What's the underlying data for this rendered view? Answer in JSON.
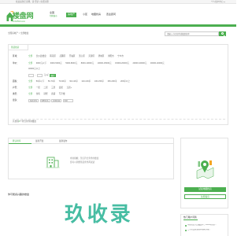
{
  "topbar": {
    "left": "欢迎来到亿房网，请 登录 | 免费注册",
    "right": "个人用户中心"
  },
  "brand": {
    "logo_cn": "楼盘网",
    "logo_en": "LOUPAN.com",
    "city": "全国",
    "city_switch": "切换城市"
  },
  "nav": {
    "items": [
      "房地产",
      "小区",
      "地图找房",
      "置业顾问"
    ],
    "active_index": 0
  },
  "breadcrumb": "全国房地产 > 全部楼盘",
  "search": {
    "placeholder": "请输入小区名称或楼盘名称",
    "button_icon": "search-icon"
  },
  "filters": {
    "tab_label": "筛选找房",
    "region": {
      "label": "区域：",
      "options": [
        "全部",
        "长沙县楼盘",
        "雨花区",
        "岳麓区",
        "开福区",
        "天心区",
        "芙蓉区",
        "望城区",
        "浏阳市",
        "宁乡市"
      ]
    },
    "price": {
      "label": "单价：",
      "options": [
        "全部",
        "3000元以下",
        "3000-5000元",
        "5000-8000元",
        "8000-10000元",
        "10000-15000元",
        "15000-20000元",
        "20000-30000元",
        "30000-40000元",
        "40000元以上"
      ],
      "range_sep": "-",
      "unit": "元/㎡",
      "confirm": "确定"
    },
    "area": {
      "label": "面积：",
      "options": [
        "全部",
        "50平以下",
        "50-70平",
        "70-90平",
        "90-110平",
        "110-130平",
        "130-150平",
        "150-200平",
        "200平以上"
      ]
    },
    "layout": {
      "label": "户型：",
      "options": [
        "全部",
        "一居",
        "二居",
        "三居",
        "四居",
        "五居+"
      ]
    },
    "type": {
      "label": "类型：",
      "options": [
        "全部",
        "住宅",
        "别墅",
        "商铺",
        "写字楼"
      ]
    },
    "more": {
      "label": "更多：",
      "selects": [
        "装修状况",
        "销售状态",
        "开盘时间",
        "特色"
      ]
    },
    "total_prefix": "共找到",
    "total_count": "0",
    "total_suffix": "个符合条件的楼盘"
  },
  "list": {
    "tabs": [
      "默认排序",
      "最新开盘",
      "最新发布"
    ],
    "empty_line1": "非常抱歉，暂无符合条件的楼盘",
    "empty_line2": "您可以调整筛选条件再试试"
  },
  "section_title": "你可能感兴趣的楼盘",
  "sidebar": {
    "primary_button": "试试地图找房",
    "secondary_button": "免费看房"
  },
  "hot": {
    "title": "热门用户问答",
    "questions": [
      "不想在买入后被套牢，2022年房价...",
      "二手房交易流程有哪些步骤？"
    ]
  },
  "watermark": "玖收录",
  "colors": {
    "accent": "#4caf50",
    "border": "#e3e3e3",
    "text": "#333333",
    "watermark": "#2eb496"
  }
}
